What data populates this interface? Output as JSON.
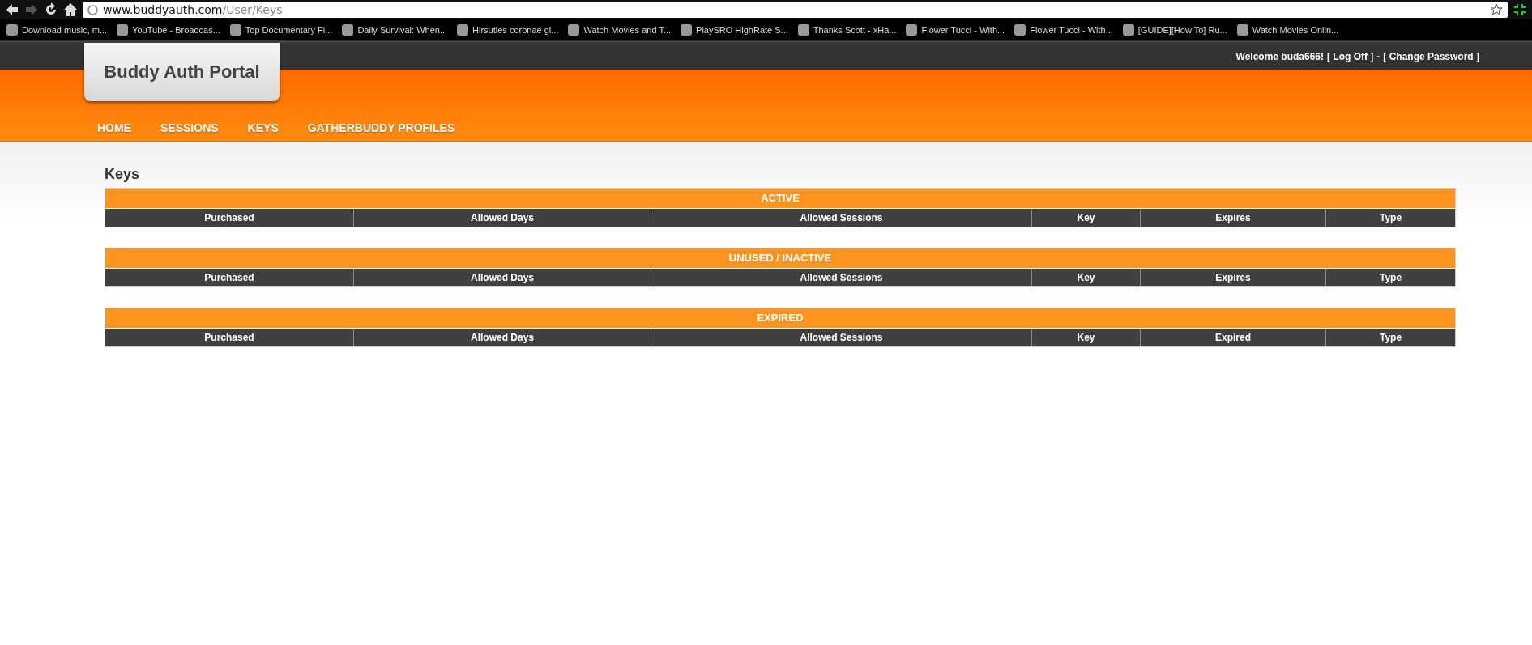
{
  "browser": {
    "url_host": "www.buddyauth.com",
    "url_path": "/User/Keys",
    "forward_disabled": true,
    "bookmarks": [
      {
        "label": "Download music, m..."
      },
      {
        "label": "YouTube - Broadcas..."
      },
      {
        "label": "Top Documentary Fi..."
      },
      {
        "label": "Daily Survival: When..."
      },
      {
        "label": "Hirsuties coronae gl..."
      },
      {
        "label": "Watch Movies and T..."
      },
      {
        "label": "PlaySRO HighRate S..."
      },
      {
        "label": "Thanks Scott - xHa..."
      },
      {
        "label": "Flower Tucci - With..."
      },
      {
        "label": "Flower Tucci - With..."
      },
      {
        "label": "[GUIDE][How To] Ru..."
      },
      {
        "label": "Watch Movies Onlin..."
      }
    ]
  },
  "header": {
    "welcome": "Welcome buda666!",
    "logoff": "[ Log Off ]",
    "separator": "-",
    "change_password": "[ Change Password ]",
    "logo": "Buddy Auth Portal",
    "nav": [
      {
        "label": "HOME"
      },
      {
        "label": "SESSIONS"
      },
      {
        "label": "KEYS"
      },
      {
        "label": "GATHERBUDDY PROFILES"
      }
    ]
  },
  "page": {
    "title": "Keys",
    "tables": [
      {
        "title": "ACTIVE",
        "columns": [
          "Purchased",
          "Allowed Days",
          "Allowed Sessions",
          "Key",
          "Expires",
          "Type"
        ]
      },
      {
        "title": "UNUSED / INACTIVE",
        "columns": [
          "Purchased",
          "Allowed Days",
          "Allowed Sessions",
          "Key",
          "Expires",
          "Type"
        ]
      },
      {
        "title": "EXPIRED",
        "columns": [
          "Purchased",
          "Allowed Days",
          "Allowed Sessions",
          "Key",
          "Expired",
          "Type"
        ]
      }
    ]
  }
}
